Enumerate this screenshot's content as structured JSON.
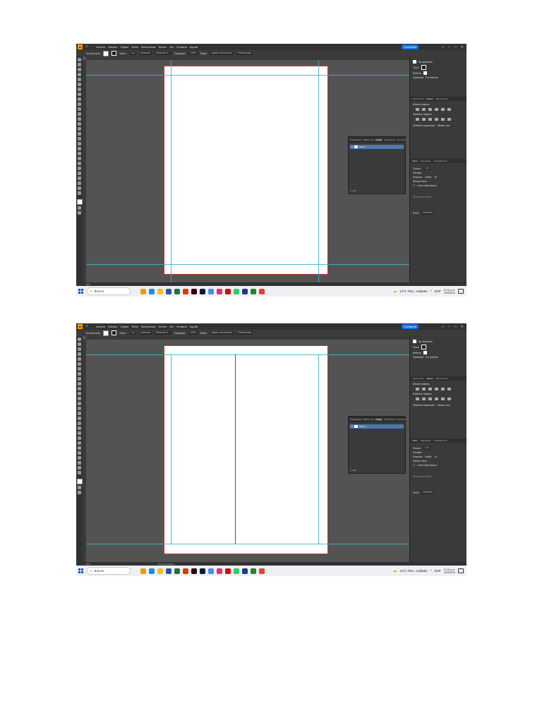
{
  "app": {
    "logo_text": "Ai",
    "menu": [
      "Archivo",
      "Edición",
      "Objeto",
      "Texto",
      "Seleccionar",
      "Efecto",
      "Ver",
      "Ventana",
      "Ayuda"
    ],
    "share_label": "Compartir"
  },
  "control_bar": {
    "selection": "No selección",
    "stroke_label": "Trazo:",
    "stroke_value": "1 pt",
    "stroke_style": "Uniforme",
    "brush": "Redondo 3...",
    "opacity_label": "Opacidad:",
    "opacity_value": "100%",
    "style_label": "Estilo:",
    "doc_setup": "Ajustar documento",
    "prefs": "Preferencias"
  },
  "layers_panel": {
    "tabs": [
      "Propiedades",
      "Bibliotecas",
      "Capas",
      "Ilustraciones",
      "Recursos"
    ],
    "active_tab": "Capas",
    "layer_name": "Capa 1",
    "footer": "1 capa"
  },
  "right_panel": {
    "no_selection": "No selección",
    "fill_label": "Trazo",
    "fill2_label": "Relleno",
    "opacity_label": "Opacidad",
    "opacity_value": "Por defecto",
    "tabs_align": [
      "Transformar",
      "Alinear",
      "Buscatrazos"
    ],
    "active_align_tab": "Alinear",
    "align_objects": "Alinear objetos:",
    "distribute_objects": "Distribuir objetos:",
    "distribute_spacing": "Distribuir espaciado:",
    "align_to": "Alinear con:",
    "tabs_stroke": [
      "Trazo",
      "Degradado",
      "Transparencia"
    ],
    "active_stroke_tab": "Trazo",
    "weight_label": "Grosor:",
    "weight_value": "1 pt",
    "cap_label": "Remate:",
    "corner_label": "Esquina:",
    "limit_label": "Límite:",
    "limit_value": "10",
    "align_stroke_label": "Alinear trazo:",
    "dashed_label": "Línea discontinua",
    "arrows_label": "Puntas de flecha:",
    "profile_label": "Perfil:",
    "profile_value": "Uniforme"
  },
  "status": {
    "zoom": "50%",
    "artboard_name": "Mesa de trabajo 1"
  },
  "taskbar": {
    "search_placeholder": "Buscar",
    "weather": "14°C Parc. nublado",
    "lang": "ESP",
    "time": "11:13 p.m.",
    "date": "9/09/2024",
    "app_colors": [
      "#e8a000",
      "#1e8fe0",
      "#f0c020",
      "#2b579a",
      "#217346",
      "#d83b01",
      "#330000",
      "#001e36",
      "#4a90e2",
      "#e1306c",
      "#cc0f16",
      "#25d366",
      "#1e3a8a",
      "#2e7d32",
      "#db4437"
    ]
  }
}
